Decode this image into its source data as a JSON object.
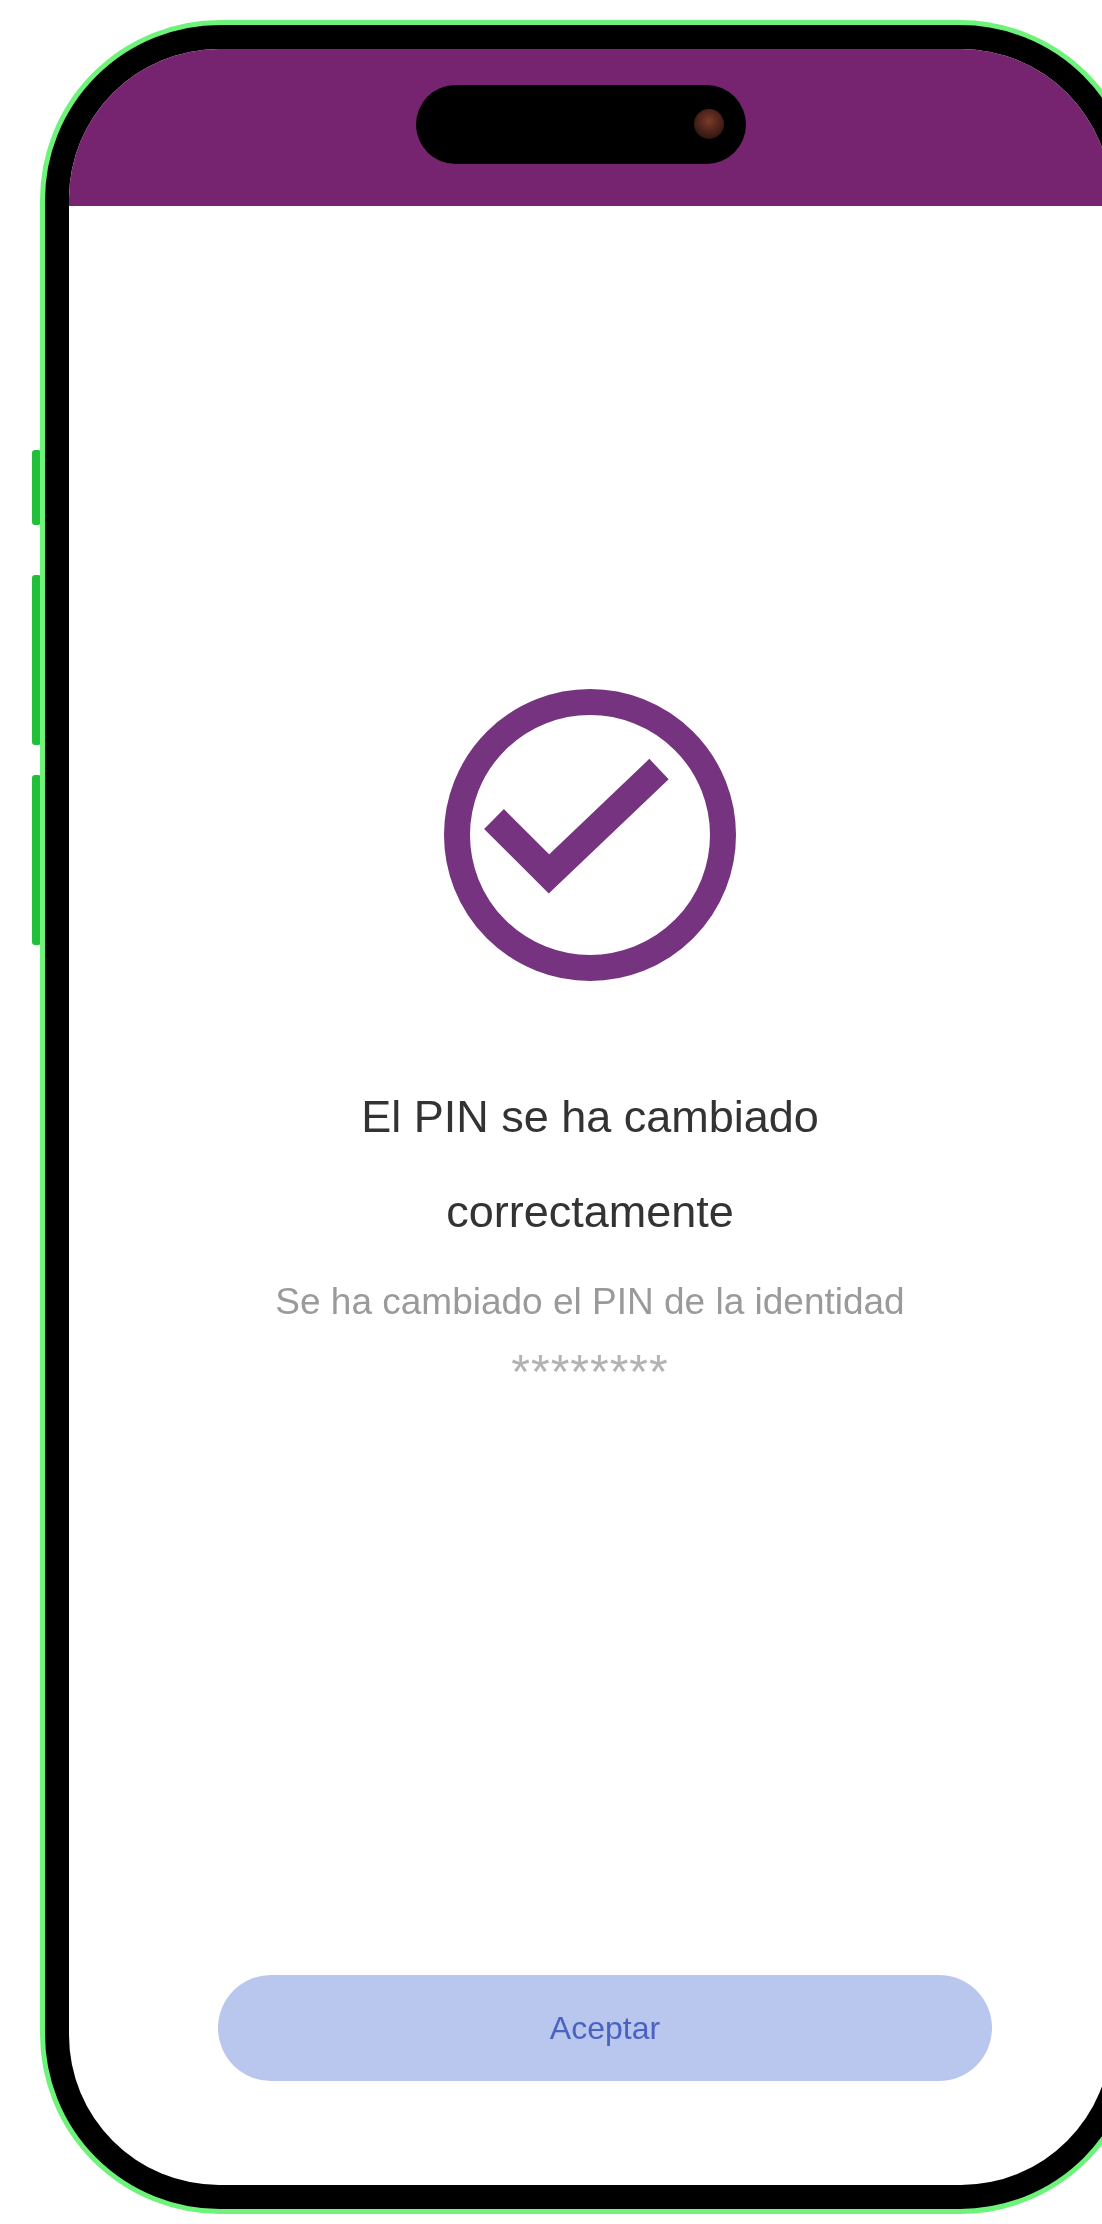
{
  "result": {
    "title": "El PIN se ha cambiado correctamente",
    "message": "Se ha cambiado el PIN de la identidad",
    "masked_identity": "********"
  },
  "buttons": [
    {
      "label": "Aceptar",
      "disabled": true
    }
  ]
}
